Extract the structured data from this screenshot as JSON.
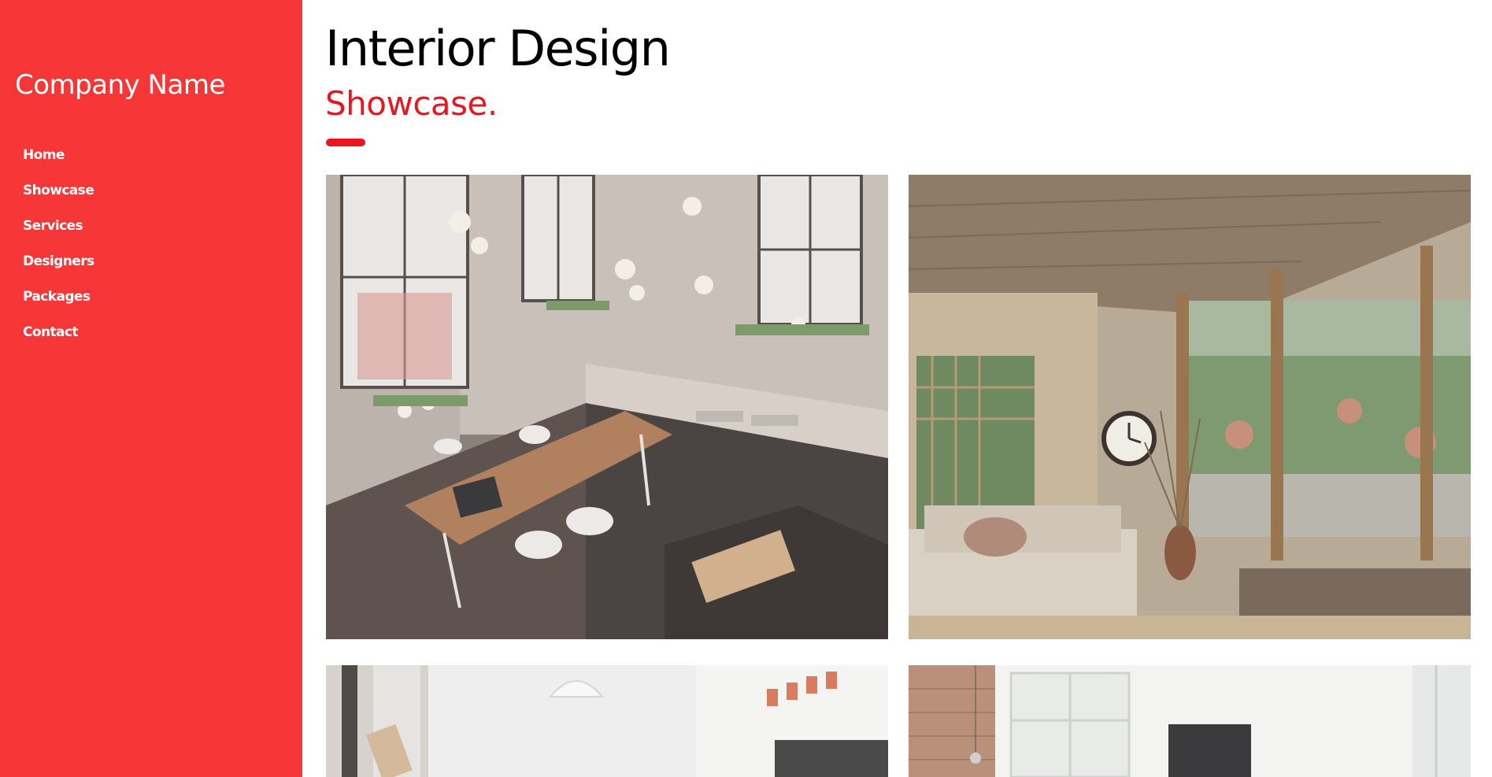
{
  "sidebar": {
    "company_name": "Company Name",
    "nav": [
      {
        "label": "Home"
      },
      {
        "label": "Showcase"
      },
      {
        "label": "Services"
      },
      {
        "label": "Designers"
      },
      {
        "label": "Packages"
      },
      {
        "label": "Contact"
      }
    ]
  },
  "header": {
    "title": "Interior Design",
    "subtitle": "Showcase."
  },
  "gallery": [
    {
      "alt": "Loft kitchen with wooden dining table"
    },
    {
      "alt": "Sunroom living area with clock and sofa"
    },
    {
      "alt": "Bright white room with pendant lamp"
    },
    {
      "alt": "White room with wood-panel wall and window"
    }
  ],
  "colors": {
    "sidebar_bg": "#f73737",
    "accent": "#e8171f",
    "text_dark": "#000000",
    "text_light": "#ffffff"
  }
}
